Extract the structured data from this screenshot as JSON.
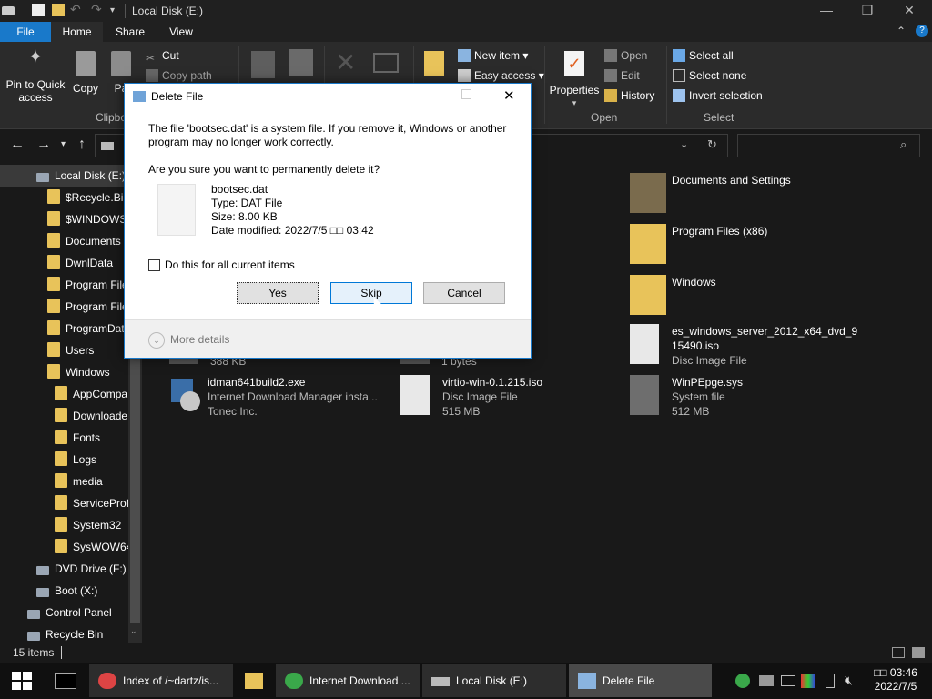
{
  "window": {
    "title": "Local Disk (E:)",
    "minimize": "—",
    "maximize": "❐",
    "close": "✕"
  },
  "ribbon_tabs": [
    "File",
    "Home",
    "Share",
    "View"
  ],
  "ribbon": {
    "clipboard": {
      "pin": "Pin to Quick access",
      "copy": "Copy",
      "paste": "Pa",
      "cut": "Cut",
      "copy_path": "Copy path",
      "group": "Clipbo"
    },
    "new": {
      "new_item": "New item ▾",
      "easy_access": "Easy access ▾"
    },
    "open": {
      "properties": "Properties",
      "open": "Open",
      "edit": "Edit",
      "history": "History",
      "group": "Open"
    },
    "select": {
      "select_all": "Select all",
      "select_none": "Select none",
      "invert": "Invert selection",
      "group": "Select"
    }
  },
  "nav": {
    "items": [
      {
        "label": "Local Disk (E:)",
        "level": 1,
        "selected": true
      },
      {
        "label": "$Recycle.Bin",
        "level": 2
      },
      {
        "label": "$WINDOWS.",
        "level": 2
      },
      {
        "label": "Documents a",
        "level": 2
      },
      {
        "label": "DwnlData",
        "level": 2
      },
      {
        "label": "Program File",
        "level": 2
      },
      {
        "label": "Program File",
        "level": 2
      },
      {
        "label": "ProgramDat",
        "level": 2
      },
      {
        "label": "Users",
        "level": 2
      },
      {
        "label": "Windows",
        "level": 2
      },
      {
        "label": "AppCompa",
        "level": 3
      },
      {
        "label": "Downloade",
        "level": 3
      },
      {
        "label": "Fonts",
        "level": 3
      },
      {
        "label": "Logs",
        "level": 3
      },
      {
        "label": "media",
        "level": 3
      },
      {
        "label": "ServiceProfi",
        "level": 3
      },
      {
        "label": "System32",
        "level": 3
      },
      {
        "label": "SysWOW64",
        "level": 3
      },
      {
        "label": "DVD Drive (F:) I",
        "level": 1
      },
      {
        "label": "Boot (X:)",
        "level": 1
      },
      {
        "label": "Control Panel",
        "level": 0
      },
      {
        "label": "Recycle Bin",
        "level": 0
      }
    ]
  },
  "files": {
    "right_col": [
      {
        "name": "Documents and Settings",
        "sub1": "",
        "sub2": ""
      },
      {
        "name": "Program Files (x86)",
        "sub1": "",
        "sub2": ""
      },
      {
        "name": "Windows",
        "sub1": "",
        "sub2": ""
      },
      {
        "name": "es_windows_server_2012_x64_dvd_9",
        "name2": "15490.iso",
        "sub1": "Disc Image File",
        "sub2": ""
      },
      {
        "name": "WinPEpge.sys",
        "sub1": "System file",
        "sub2": "512 MB"
      }
    ],
    "partial": {
      "left_size": "388 KB",
      "mid_size": "1 bytes"
    },
    "idman": {
      "name": "idman641build2.exe",
      "sub1": "Internet Download Manager insta...",
      "sub2": "Tonec Inc."
    },
    "virtio": {
      "name": "virtio-win-0.1.215.iso",
      "sub1": "Disc Image File",
      "sub2": "515 MB"
    }
  },
  "status": {
    "count": "15 items"
  },
  "dialog": {
    "title": "Delete File",
    "warning_line1": "The file 'bootsec.dat' is a system file. If you remove it, Windows or another",
    "warning_line2": "program may no longer work correctly.",
    "question": "Are you sure you want to permanently delete it?",
    "file_name": "bootsec.dat",
    "file_type": "Type: DAT File",
    "file_size": "Size: 8.00 KB",
    "file_modified": "Date modified: 2022/7/5 □□ 03:42",
    "checkbox_label": "Do this for all current items",
    "yes": "Yes",
    "skip": "Skip",
    "cancel": "Cancel",
    "more_details": "More details"
  },
  "taskbar": {
    "buttons": [
      {
        "label": "Index of /~dartz/is...",
        "icon": "chrome-icon"
      },
      {
        "label": "",
        "icon": "file-explorer-icon"
      },
      {
        "label": "Internet Download ...",
        "icon": "idm-icon"
      },
      {
        "label": "Local Disk (E:)",
        "icon": "drive-icon"
      },
      {
        "label": "Delete File",
        "icon": "dialog-icon",
        "active": true
      }
    ],
    "time": "03:46",
    "date": "2022/7/5",
    "ampm": "□□"
  }
}
